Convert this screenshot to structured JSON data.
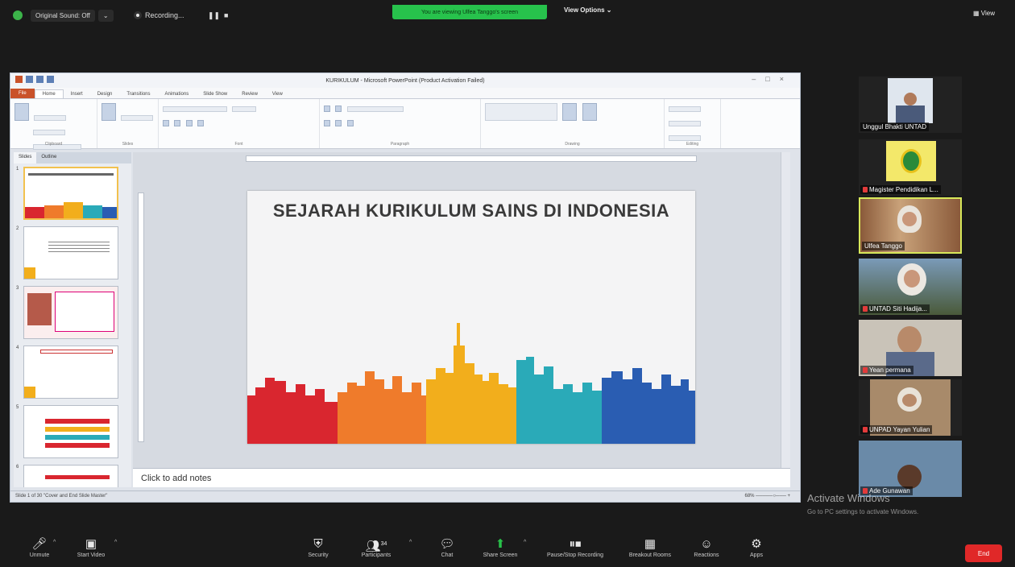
{
  "topbar": {
    "original_sound": "Original Sound: Off",
    "recording": "Recording...",
    "share_banner": "You are viewing Ulfea Tanggo's screen",
    "view_options": "View Options",
    "view_button": "View"
  },
  "ppt": {
    "window_title": "KURIKULUM - Microsoft PowerPoint (Product Activation Failed)",
    "tabs": [
      "File",
      "Home",
      "Insert",
      "Design",
      "Transitions",
      "Animations",
      "Slide Show",
      "Review",
      "View"
    ],
    "active_tab": "Home",
    "groups": [
      "Clipboard",
      "Slides",
      "Font",
      "Paragraph",
      "Drawing",
      "Editing"
    ],
    "pane_tabs": [
      "Slides",
      "Outline"
    ],
    "slide_title": "SEJARAH KURIKULUM SAINS DI INDONESIA",
    "notes_placeholder": "Click to add notes",
    "status": "Slide 1 of 30   \"Cover and End Slide Master\"",
    "zoom": "68%",
    "thumb_numbers": [
      "1",
      "2",
      "3",
      "4",
      "5",
      "6"
    ],
    "colors": {
      "red": "#d9262f",
      "orange": "#ef7b2b",
      "yellow": "#f2ae1c",
      "teal": "#2aaab8",
      "blue": "#2a5db2"
    }
  },
  "participants": [
    {
      "name": "Unggul Bhakti UNTAD",
      "muted": false
    },
    {
      "name": "Magister Pendidikan L...",
      "muted": true
    },
    {
      "name": "Ulfea Tanggo",
      "muted": false
    },
    {
      "name": "UNTAD Siti Hadija...",
      "muted": true
    },
    {
      "name": "Yean permana",
      "muted": true
    },
    {
      "name": "UNPAD Yayan Yulian",
      "muted": true
    },
    {
      "name": "Ade Gunawan",
      "muted": true
    }
  ],
  "watermark": {
    "title": "Activate Windows",
    "subtitle": "Go to PC settings to activate Windows."
  },
  "toolbar": {
    "unmute": "Unmute",
    "start_video": "Start Video",
    "security": "Security",
    "participants": "Participants",
    "participants_count": "34",
    "chat": "Chat",
    "share_screen": "Share Screen",
    "pause_recording": "Pause/Stop Recording",
    "breakout_rooms": "Breakout Rooms",
    "reactions": "Reactions",
    "apps": "Apps",
    "end": "End"
  }
}
